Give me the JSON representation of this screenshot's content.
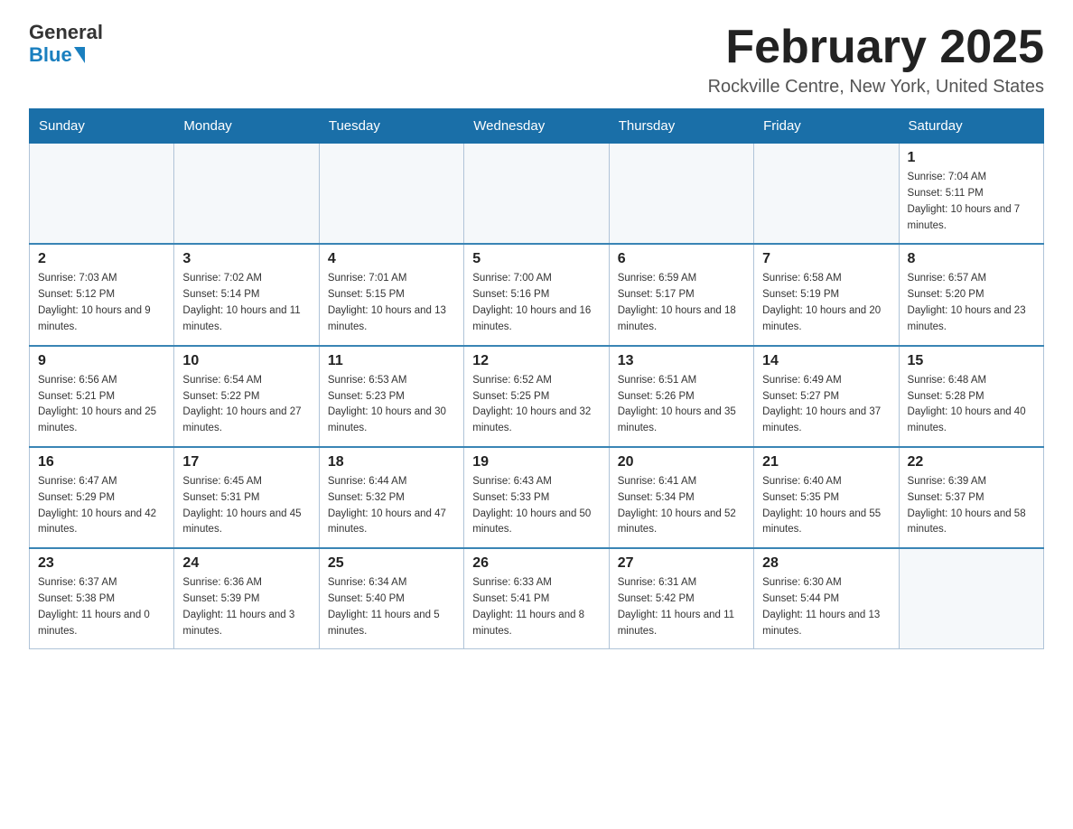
{
  "logo": {
    "general": "General",
    "blue": "Blue"
  },
  "header": {
    "title": "February 2025",
    "location": "Rockville Centre, New York, United States"
  },
  "weekdays": [
    "Sunday",
    "Monday",
    "Tuesday",
    "Wednesday",
    "Thursday",
    "Friday",
    "Saturday"
  ],
  "weeks": [
    [
      {
        "day": "",
        "info": ""
      },
      {
        "day": "",
        "info": ""
      },
      {
        "day": "",
        "info": ""
      },
      {
        "day": "",
        "info": ""
      },
      {
        "day": "",
        "info": ""
      },
      {
        "day": "",
        "info": ""
      },
      {
        "day": "1",
        "info": "Sunrise: 7:04 AM\nSunset: 5:11 PM\nDaylight: 10 hours and 7 minutes."
      }
    ],
    [
      {
        "day": "2",
        "info": "Sunrise: 7:03 AM\nSunset: 5:12 PM\nDaylight: 10 hours and 9 minutes."
      },
      {
        "day": "3",
        "info": "Sunrise: 7:02 AM\nSunset: 5:14 PM\nDaylight: 10 hours and 11 minutes."
      },
      {
        "day": "4",
        "info": "Sunrise: 7:01 AM\nSunset: 5:15 PM\nDaylight: 10 hours and 13 minutes."
      },
      {
        "day": "5",
        "info": "Sunrise: 7:00 AM\nSunset: 5:16 PM\nDaylight: 10 hours and 16 minutes."
      },
      {
        "day": "6",
        "info": "Sunrise: 6:59 AM\nSunset: 5:17 PM\nDaylight: 10 hours and 18 minutes."
      },
      {
        "day": "7",
        "info": "Sunrise: 6:58 AM\nSunset: 5:19 PM\nDaylight: 10 hours and 20 minutes."
      },
      {
        "day": "8",
        "info": "Sunrise: 6:57 AM\nSunset: 5:20 PM\nDaylight: 10 hours and 23 minutes."
      }
    ],
    [
      {
        "day": "9",
        "info": "Sunrise: 6:56 AM\nSunset: 5:21 PM\nDaylight: 10 hours and 25 minutes."
      },
      {
        "day": "10",
        "info": "Sunrise: 6:54 AM\nSunset: 5:22 PM\nDaylight: 10 hours and 27 minutes."
      },
      {
        "day": "11",
        "info": "Sunrise: 6:53 AM\nSunset: 5:23 PM\nDaylight: 10 hours and 30 minutes."
      },
      {
        "day": "12",
        "info": "Sunrise: 6:52 AM\nSunset: 5:25 PM\nDaylight: 10 hours and 32 minutes."
      },
      {
        "day": "13",
        "info": "Sunrise: 6:51 AM\nSunset: 5:26 PM\nDaylight: 10 hours and 35 minutes."
      },
      {
        "day": "14",
        "info": "Sunrise: 6:49 AM\nSunset: 5:27 PM\nDaylight: 10 hours and 37 minutes."
      },
      {
        "day": "15",
        "info": "Sunrise: 6:48 AM\nSunset: 5:28 PM\nDaylight: 10 hours and 40 minutes."
      }
    ],
    [
      {
        "day": "16",
        "info": "Sunrise: 6:47 AM\nSunset: 5:29 PM\nDaylight: 10 hours and 42 minutes."
      },
      {
        "day": "17",
        "info": "Sunrise: 6:45 AM\nSunset: 5:31 PM\nDaylight: 10 hours and 45 minutes."
      },
      {
        "day": "18",
        "info": "Sunrise: 6:44 AM\nSunset: 5:32 PM\nDaylight: 10 hours and 47 minutes."
      },
      {
        "day": "19",
        "info": "Sunrise: 6:43 AM\nSunset: 5:33 PM\nDaylight: 10 hours and 50 minutes."
      },
      {
        "day": "20",
        "info": "Sunrise: 6:41 AM\nSunset: 5:34 PM\nDaylight: 10 hours and 52 minutes."
      },
      {
        "day": "21",
        "info": "Sunrise: 6:40 AM\nSunset: 5:35 PM\nDaylight: 10 hours and 55 minutes."
      },
      {
        "day": "22",
        "info": "Sunrise: 6:39 AM\nSunset: 5:37 PM\nDaylight: 10 hours and 58 minutes."
      }
    ],
    [
      {
        "day": "23",
        "info": "Sunrise: 6:37 AM\nSunset: 5:38 PM\nDaylight: 11 hours and 0 minutes."
      },
      {
        "day": "24",
        "info": "Sunrise: 6:36 AM\nSunset: 5:39 PM\nDaylight: 11 hours and 3 minutes."
      },
      {
        "day": "25",
        "info": "Sunrise: 6:34 AM\nSunset: 5:40 PM\nDaylight: 11 hours and 5 minutes."
      },
      {
        "day": "26",
        "info": "Sunrise: 6:33 AM\nSunset: 5:41 PM\nDaylight: 11 hours and 8 minutes."
      },
      {
        "day": "27",
        "info": "Sunrise: 6:31 AM\nSunset: 5:42 PM\nDaylight: 11 hours and 11 minutes."
      },
      {
        "day": "28",
        "info": "Sunrise: 6:30 AM\nSunset: 5:44 PM\nDaylight: 11 hours and 13 minutes."
      },
      {
        "day": "",
        "info": ""
      }
    ]
  ]
}
